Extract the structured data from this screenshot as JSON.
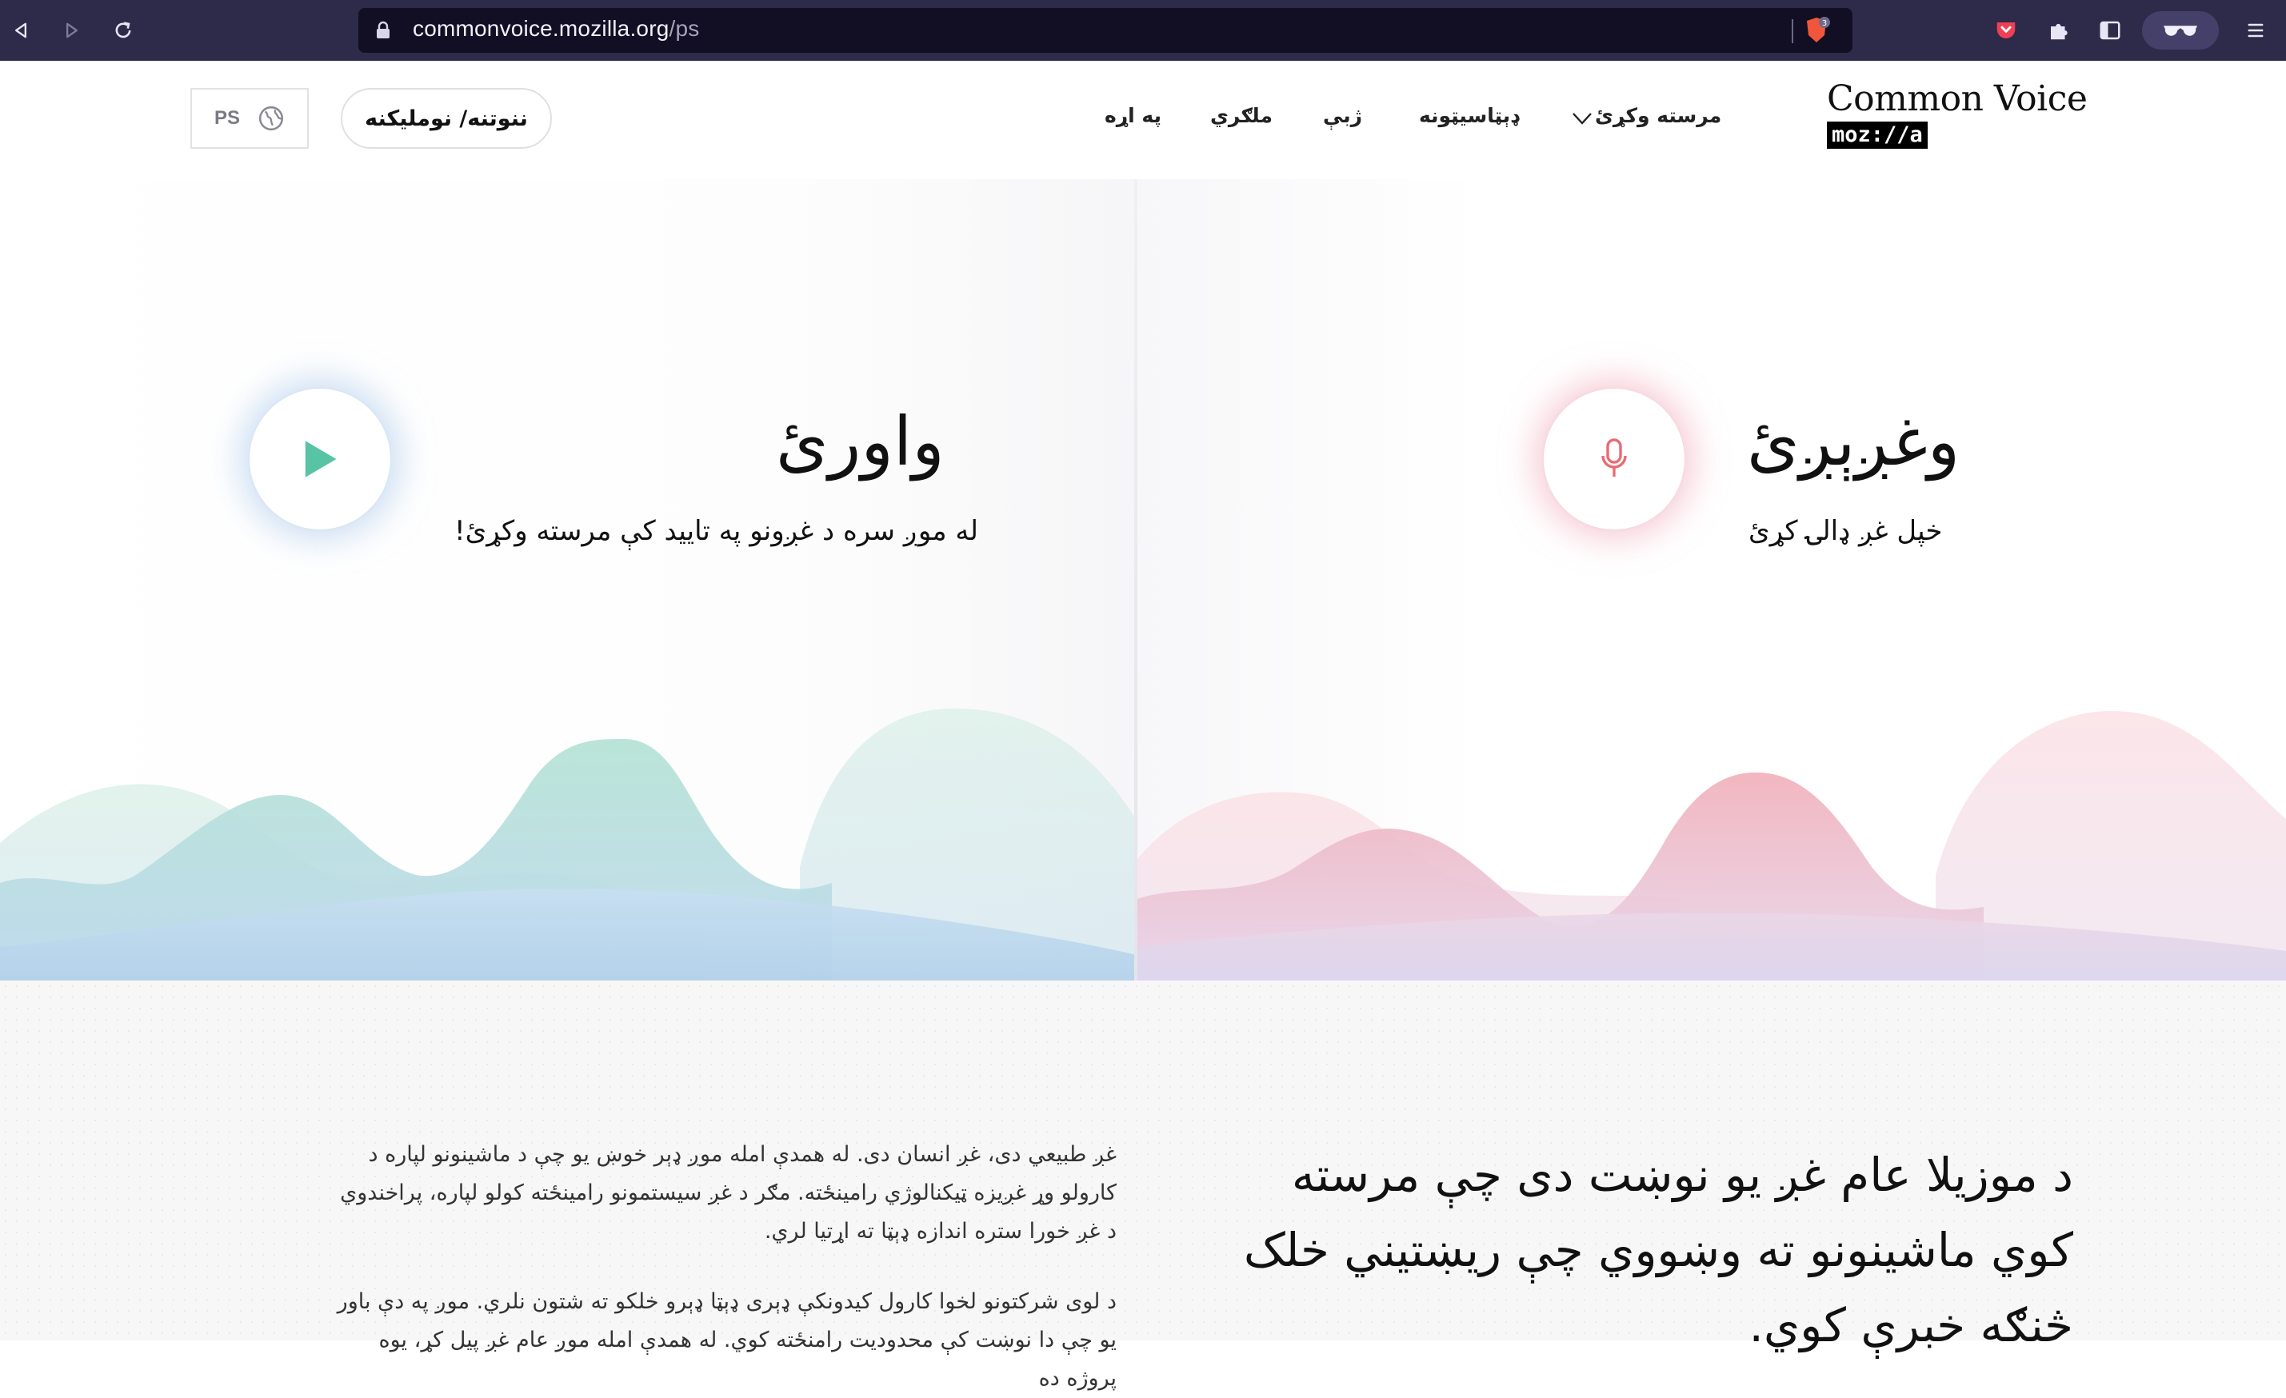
{
  "browser": {
    "url_host": "commonvoice.mozilla.org",
    "url_path": "/ps",
    "shield_count": "3"
  },
  "header": {
    "brand_name": "Common Voice",
    "brand_sub": "moz://a",
    "nav": {
      "contribute": "مرسته وکړئ",
      "datasets": "ډېټاسيټونه",
      "languages": "ژبې",
      "partner": "ملګري",
      "about": "په اړه"
    },
    "login_label": "ننوتنه/ نوملیکنه",
    "language_code": "PS"
  },
  "hero": {
    "speak": {
      "title": "وغږېږئ",
      "subtitle": "خپل غږ ډالۍ کړئ"
    },
    "listen": {
      "title": "واورئ",
      "subtitle": "له موږ سره د غږونو په تایید کې مرسته وکړئ!"
    }
  },
  "about": {
    "heading": "د موزیلا عام غږ یو نوښت دی چې مرسته کوي ماشینونو ته وښووي چې ریښتیني خلک څنګه خبرې کوي.",
    "para1": "غږ طبیعي دی، غږ انسان دی. له همدې امله موږ ډېر خوښ یو چې د ماشینونو لپاره د کارولو وړ غږیزه ټیکنالوژي رامینځته. مګر د غږ سیستمونو رامینځته کولو لپاره، پراخندوي د غږ خورا ستره اندازه ډېټا ته اړتیا لري.",
    "para2": "د لوی شرکتونو لخوا کارول کیدونکې ډېری ډېټا ډېرو خلکو ته شتون نلري. موږ په دې باور یو چې دا نوښت کې محدودیت رامنځته کوي. له همدې امله موږ عام غږ پیل کړ، یوه پروژه ده"
  },
  "colors": {
    "chrome_bg": "#2d2a4a",
    "url_bg": "#120f24",
    "play_accent": "#59c3a6",
    "mic_accent": "#e96b74"
  }
}
